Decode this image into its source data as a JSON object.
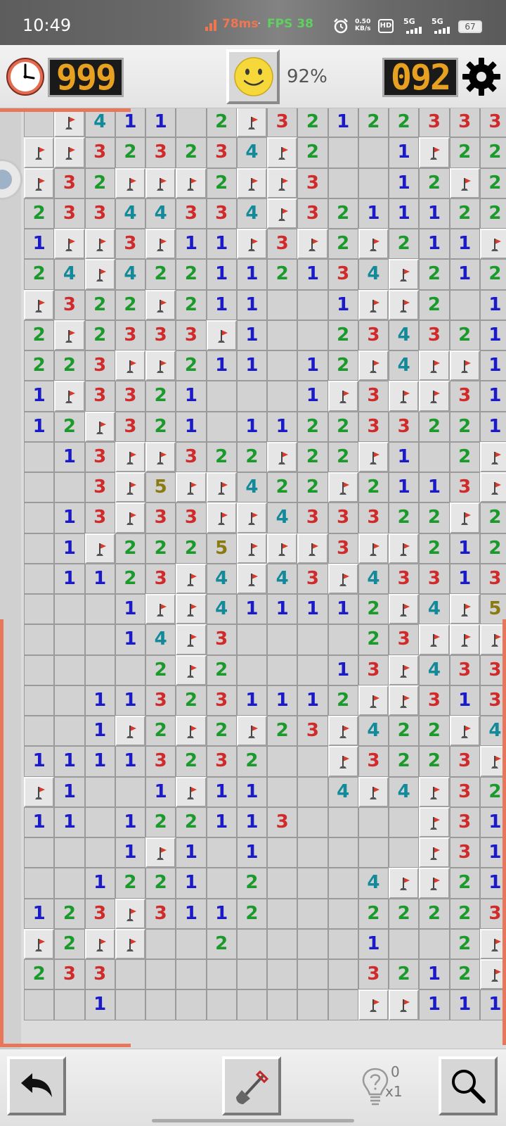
{
  "status_bar": {
    "time": "10:49",
    "ping": "78ms",
    "separator": "·",
    "fps": "FPS 38",
    "net_speed_value": "0.50",
    "net_speed_unit": "KB/s",
    "hd_label": "HD",
    "network1": "5G",
    "network2": "5G",
    "battery": "67"
  },
  "header": {
    "timer": "999",
    "mines_remaining": "092",
    "progress": "92%"
  },
  "hints": {
    "count": "0",
    "multiplier": "x1"
  },
  "colors": {
    "n1": "#1a1ac8",
    "n2": "#1a9a2a",
    "n3": "#d02a2a",
    "n4": "#138a9a",
    "n5": "#8a7a10",
    "accent": "#e8765a",
    "digit": "#e8a020"
  },
  "board": {
    "columns": 16,
    "rows": [
      [
        "",
        "F",
        "4",
        "1",
        "1",
        "",
        "2",
        "F",
        "3",
        "2",
        "1",
        "2",
        "2",
        "3",
        "3",
        "3"
      ],
      [
        "F",
        "F",
        "3",
        "2",
        "3",
        "2",
        "3",
        "4",
        "F",
        "2",
        "",
        "",
        "1",
        "F",
        "2",
        "2"
      ],
      [
        "F",
        "3",
        "2",
        "F",
        "F",
        "F",
        "2",
        "F",
        "F",
        "3",
        "",
        "",
        "1",
        "2",
        "F",
        "2"
      ],
      [
        "2",
        "3",
        "3",
        "4",
        "4",
        "3",
        "3",
        "4",
        "F",
        "3",
        "2",
        "1",
        "1",
        "1",
        "2",
        "2"
      ],
      [
        "1",
        "F",
        "F",
        "3",
        "F",
        "1",
        "1",
        "F",
        "3",
        "F",
        "2",
        "F",
        "2",
        "1",
        "1",
        "F"
      ],
      [
        "2",
        "4",
        "F",
        "4",
        "2",
        "2",
        "1",
        "1",
        "2",
        "1",
        "3",
        "4",
        "F",
        "2",
        "1",
        "2"
      ],
      [
        "F",
        "3",
        "2",
        "2",
        "F",
        "2",
        "1",
        "1",
        "",
        "",
        "1",
        "F",
        "F",
        "2",
        "",
        "1"
      ],
      [
        "2",
        "F",
        "2",
        "3",
        "3",
        "3",
        "F",
        "1",
        "",
        "",
        "2",
        "3",
        "4",
        "3",
        "2",
        "1"
      ],
      [
        "2",
        "2",
        "3",
        "F",
        "F",
        "2",
        "1",
        "1",
        "",
        "1",
        "2",
        "F",
        "4",
        "F",
        "F",
        "1"
      ],
      [
        "1",
        "F",
        "3",
        "3",
        "2",
        "1",
        "",
        "",
        "",
        "1",
        "F",
        "3",
        "F",
        "F",
        "3",
        "1"
      ],
      [
        "1",
        "2",
        "F",
        "3",
        "2",
        "1",
        "",
        "1",
        "1",
        "2",
        "2",
        "3",
        "3",
        "2",
        "2",
        "1"
      ],
      [
        "",
        "1",
        "3",
        "F",
        "F",
        "3",
        "2",
        "2",
        "F",
        "2",
        "2",
        "F",
        "1",
        "",
        "2",
        "F"
      ],
      [
        "",
        "",
        "3",
        "F",
        "5",
        "F",
        "F",
        "4",
        "2",
        "2",
        "F",
        "2",
        "1",
        "1",
        "3",
        "F"
      ],
      [
        "",
        "1",
        "3",
        "F",
        "3",
        "3",
        "F",
        "F",
        "4",
        "3",
        "3",
        "3",
        "2",
        "2",
        "F",
        "2"
      ],
      [
        "",
        "1",
        "F",
        "2",
        "2",
        "2",
        "5",
        "F",
        "F",
        "F",
        "3",
        "F",
        "F",
        "2",
        "1",
        "2"
      ],
      [
        "",
        "1",
        "1",
        "2",
        "3",
        "F",
        "4",
        "F",
        "4",
        "3",
        "F",
        "4",
        "3",
        "3",
        "1",
        "3"
      ],
      [
        "",
        "",
        "",
        "1",
        "F",
        "F",
        "4",
        "1",
        "1",
        "1",
        "1",
        "2",
        "F",
        "4",
        "F",
        "5"
      ],
      [
        "",
        "",
        "",
        "1",
        "4",
        "F",
        "3",
        "",
        "",
        "",
        "",
        "2",
        "3",
        "F",
        "F",
        "F"
      ],
      [
        "",
        "",
        "",
        "",
        "2",
        "F",
        "2",
        "",
        "",
        "",
        "1",
        "3",
        "F",
        "4",
        "3",
        "3"
      ],
      [
        "",
        "",
        "1",
        "1",
        "3",
        "2",
        "3",
        "1",
        "1",
        "1",
        "2",
        "F",
        "F",
        "3",
        "1",
        "3"
      ],
      [
        "",
        "",
        "1",
        "F",
        "2",
        "F",
        "2",
        "F",
        "2",
        "3",
        "F",
        "4",
        "2",
        "2",
        "F",
        "4"
      ],
      [
        "1",
        "1",
        "1",
        "1",
        "3",
        "2",
        "3",
        "2",
        "",
        "",
        "F",
        "3",
        "2",
        "2",
        "3",
        "F"
      ],
      [
        "F",
        "1",
        "",
        "",
        "1",
        "F",
        "1",
        "1",
        "",
        "",
        "4",
        "F",
        "4",
        "F",
        "3",
        "2"
      ],
      [
        "1",
        "1",
        "",
        "1",
        "2",
        "2",
        "1",
        "1",
        "3",
        "",
        "",
        "",
        "",
        "F",
        "3",
        "1"
      ],
      [
        "",
        "",
        "",
        "1",
        "F",
        "1",
        "",
        "1",
        "",
        "",
        "",
        "",
        "",
        "F",
        "3",
        "1"
      ],
      [
        "",
        "",
        "1",
        "2",
        "2",
        "1",
        "",
        "2",
        "",
        "",
        "",
        "4",
        "F",
        "F",
        "2",
        "1"
      ],
      [
        "1",
        "2",
        "3",
        "F",
        "3",
        "1",
        "1",
        "2",
        "",
        "",
        "",
        "2",
        "2",
        "2",
        "2",
        "3"
      ],
      [
        "F",
        "2",
        "F",
        "F",
        "",
        "",
        "2",
        "",
        "",
        "",
        "",
        "1",
        "",
        "",
        "2",
        "F"
      ],
      [
        "2",
        "3",
        "3",
        "",
        "",
        "",
        "",
        "",
        "",
        "",
        "",
        "3",
        "2",
        "1",
        "2",
        "F"
      ],
      [
        "",
        "",
        "1",
        "",
        "",
        "",
        "",
        "",
        "",
        "",
        "",
        "F",
        "F",
        "1",
        "1",
        "1"
      ]
    ]
  }
}
